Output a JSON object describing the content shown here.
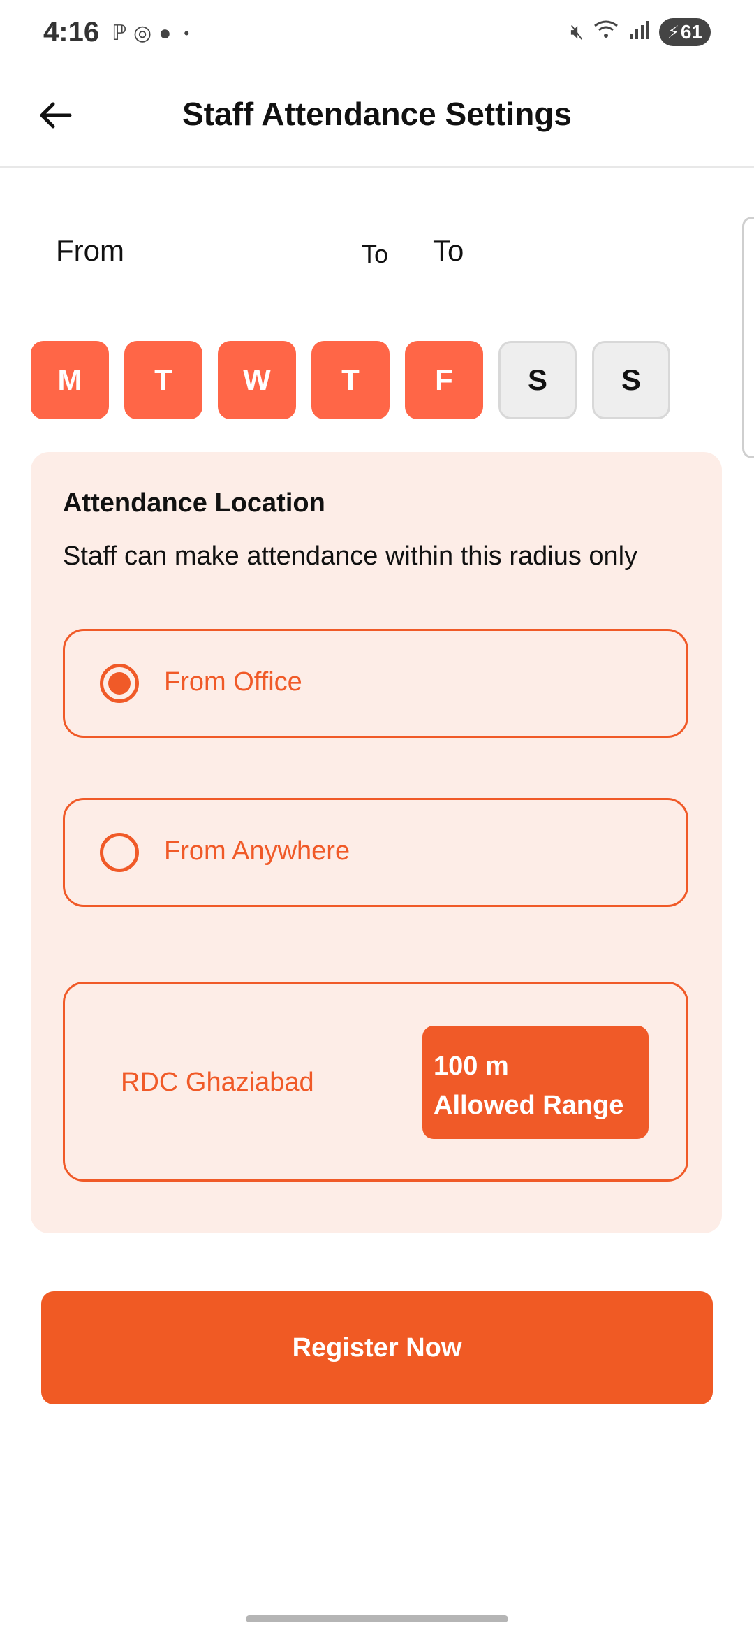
{
  "status_bar": {
    "time": "4:16",
    "battery": "61",
    "left_icons": [
      "pay-icon",
      "whatsapp-icon",
      "chat-icon"
    ],
    "right_icons": [
      "mute-icon",
      "wifi-icon",
      "signal-icon",
      "battery-icon"
    ]
  },
  "header": {
    "title": "Staff Attendance Settings",
    "back_icon": "arrow-left-icon"
  },
  "time_range": {
    "from_placeholder": "From",
    "to_separator": "To",
    "to_placeholder": "To"
  },
  "days": [
    {
      "label": "M",
      "selected": true
    },
    {
      "label": "T",
      "selected": true
    },
    {
      "label": "W",
      "selected": true
    },
    {
      "label": "T",
      "selected": true
    },
    {
      "label": "F",
      "selected": true
    },
    {
      "label": "S",
      "selected": false
    },
    {
      "label": "S",
      "selected": false
    }
  ],
  "attendance_location": {
    "title": "Attendance Location",
    "subtitle": "Staff can make attendance within this radius only",
    "options": [
      {
        "label": "From Office",
        "selected": true
      },
      {
        "label": "From Anywhere",
        "selected": false
      }
    ],
    "location": {
      "name": "RDC Ghaziabad",
      "range_value": "100 m",
      "range_label": "Allowed Range"
    }
  },
  "register_button": "Register Now",
  "colors": {
    "accent": "#F05A28",
    "chip_active": "#FF6647",
    "card_bg": "#FDEDE7",
    "chip_inactive": "#EEEEEE"
  }
}
